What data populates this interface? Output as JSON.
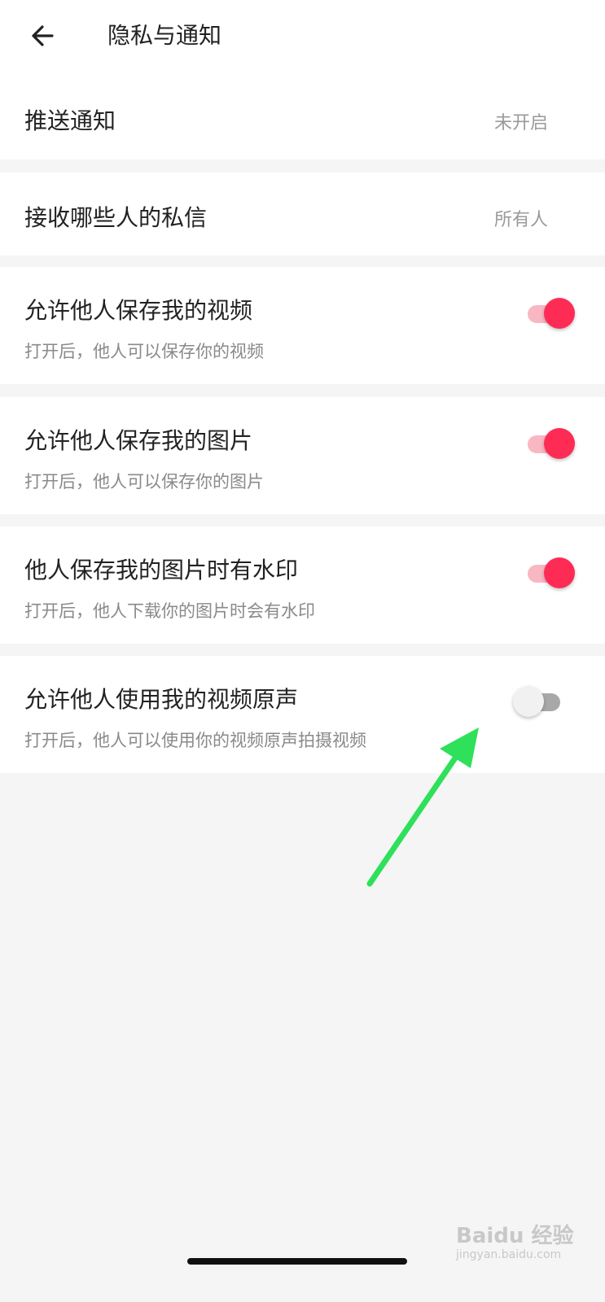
{
  "header": {
    "title": "隐私与通知",
    "back_icon": "arrow-left-icon"
  },
  "rows": [
    {
      "label": "推送通知",
      "value": "未开启"
    },
    {
      "label": "接收哪些人的私信",
      "value": "所有人"
    },
    {
      "label": "允许他人保存我的视频",
      "desc": "打开后，他人可以保存你的视频",
      "on": true
    },
    {
      "label": "允许他人保存我的图片",
      "desc": "打开后，他人可以保存你的图片",
      "on": true
    },
    {
      "label": "他人保存我的图片时有水印",
      "desc": "打开后，他人下载你的图片时会有水印",
      "on": true
    },
    {
      "label": "允许他人使用我的视频原声",
      "desc": "打开后，他人可以使用你的视频原声拍摄视频",
      "on": false
    }
  ],
  "colors": {
    "accent": "#fe2c55",
    "accent_track": "#f9b7c4",
    "annotation_arrow": "#2fe05a"
  },
  "watermark": {
    "text": "Baidu 经验",
    "sub": "jingyan.baidu.com"
  }
}
